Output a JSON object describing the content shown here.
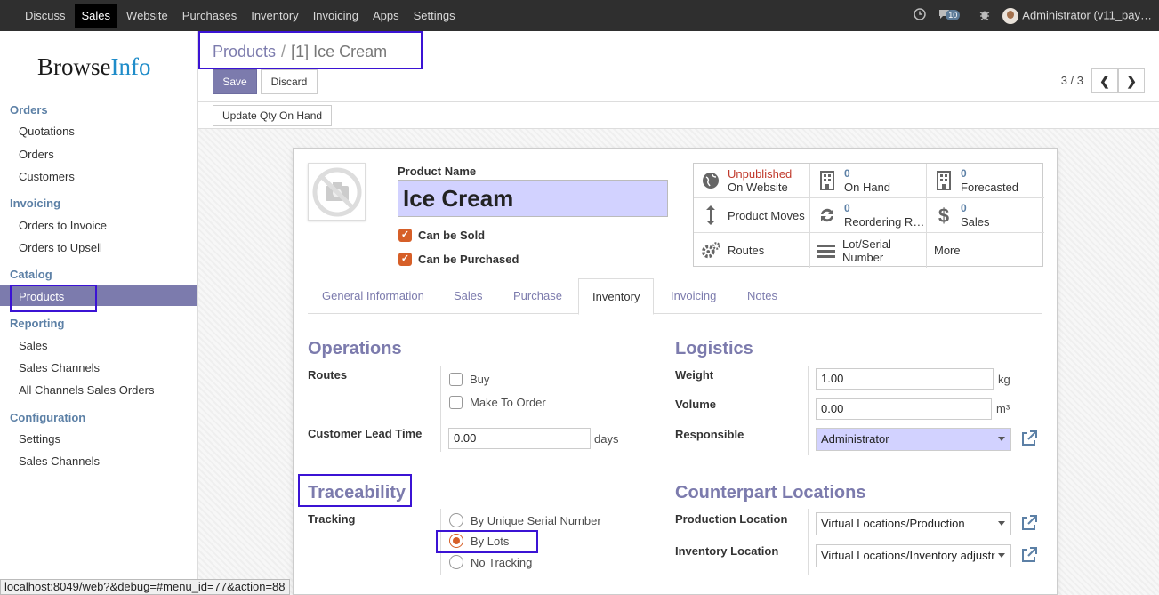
{
  "topbar": {
    "menu": [
      "Discuss",
      "Sales",
      "Website",
      "Purchases",
      "Inventory",
      "Invoicing",
      "Apps",
      "Settings"
    ],
    "active_menu": "Sales",
    "message_count": "10",
    "user": "Administrator (v11_pay…"
  },
  "sidebar": {
    "logo_browse": "Browse",
    "logo_info": "Info",
    "sections": [
      {
        "title": "Orders",
        "items": [
          "Quotations",
          "Orders",
          "Customers"
        ]
      },
      {
        "title": "Invoicing",
        "items": [
          "Orders to Invoice",
          "Orders to Upsell"
        ]
      },
      {
        "title": "Catalog",
        "items": [
          "Products"
        ]
      },
      {
        "title": "Reporting",
        "items": [
          "Sales",
          "Sales Channels",
          "All Channels Sales Orders"
        ]
      },
      {
        "title": "Configuration",
        "items": [
          "Settings",
          "Sales Channels"
        ]
      }
    ]
  },
  "control": {
    "breadcrumb_parent": "Products",
    "breadcrumb_sep": "/",
    "breadcrumb_current": "[1] Ice Cream",
    "save_label": "Save",
    "discard_label": "Discard",
    "pager": "3 / 3",
    "update_qty_label": "Update Qty On Hand"
  },
  "product": {
    "name_label": "Product Name",
    "name": "Ice Cream",
    "can_be_sold_label": "Can be Sold",
    "can_be_purchased_label": "Can be Purchased"
  },
  "smart_buttons": [
    {
      "top": "Unpublished",
      "bottom": "On Website"
    },
    {
      "top": "0",
      "bottom": "On Hand"
    },
    {
      "top": "0",
      "bottom": "Forecasted"
    },
    {
      "top": "",
      "bottom": "Product Moves"
    },
    {
      "top": "0",
      "bottom": "Reordering R…"
    },
    {
      "top": "0",
      "bottom": "Sales"
    },
    {
      "top": "",
      "bottom": "Routes"
    },
    {
      "top": "",
      "bottom": "Lot/Serial Number"
    },
    {
      "top": "",
      "bottom": "More"
    }
  ],
  "tabs": [
    "General Information",
    "Sales",
    "Purchase",
    "Inventory",
    "Invoicing",
    "Notes"
  ],
  "active_tab": "Inventory",
  "operations": {
    "title": "Operations",
    "routes_label": "Routes",
    "route_options": [
      "Buy",
      "Make To Order"
    ],
    "lead_time_label": "Customer Lead Time",
    "lead_time_value": "0.00",
    "lead_time_unit": "days"
  },
  "logistics": {
    "title": "Logistics",
    "weight_label": "Weight",
    "weight_value": "1.00",
    "weight_unit": "kg",
    "volume_label": "Volume",
    "volume_value": "0.00",
    "volume_unit": "m³",
    "responsible_label": "Responsible",
    "responsible_value": "Administrator"
  },
  "traceability": {
    "title": "Traceability",
    "tracking_label": "Tracking",
    "options": [
      "By Unique Serial Number",
      "By Lots",
      "No Tracking"
    ],
    "selected": "By Lots"
  },
  "counterpart": {
    "title": "Counterpart Locations",
    "production_label": "Production Location",
    "production_value": "Virtual Locations/Production",
    "inventory_label": "Inventory Location",
    "inventory_value": "Virtual Locations/Inventory adjustr"
  },
  "status_url": "localhost:8049/web?&debug=#menu_id=77&action=88",
  "colors": {
    "primary": "#7c7bad",
    "accent": "#d65f28",
    "highlight_box": "#3b13d4",
    "topbar": "#2f2f2f"
  }
}
